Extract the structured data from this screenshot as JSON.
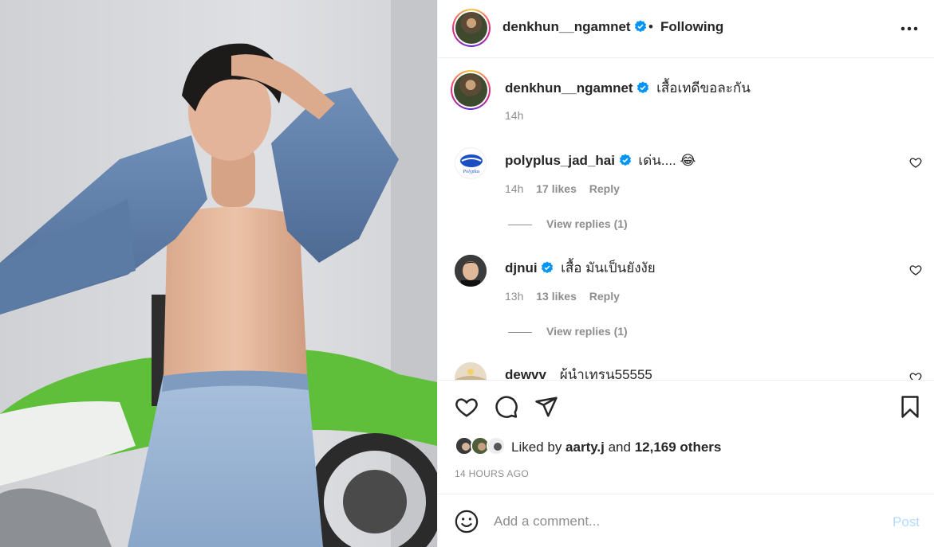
{
  "post": {
    "author": "denkhun__ngamnet",
    "follow_status": "Following",
    "separator": "•",
    "caption": "เสื้อเทดีขอละกัน",
    "caption_time": "14h"
  },
  "comments": [
    {
      "user": "polyplus_jad_hai",
      "verified": true,
      "text": "เด่น.... 😂",
      "time": "14h",
      "likes": "17 likes",
      "reply": "Reply",
      "view_replies": "View replies (1)"
    },
    {
      "user": "djnui",
      "verified": true,
      "text": "เสื้อ มันเป็นยังงัย",
      "time": "13h",
      "likes": "13 likes",
      "reply": "Reply",
      "view_replies": "View replies (1)"
    },
    {
      "user": "dewvv",
      "verified": false,
      "text": "ผู้นำเทรน55555"
    }
  ],
  "likes": {
    "prefix": "Liked by ",
    "user": "aarty.j",
    "mid": " and ",
    "count": "12,169 others"
  },
  "timestamp": "14 HOURS AGO",
  "composer": {
    "placeholder": "Add a comment...",
    "post_label": "Post"
  },
  "icons": {
    "like": "heart-icon",
    "comment": "comment-bubble-icon",
    "share": "paper-plane-icon",
    "save": "bookmark-icon",
    "more": "more-horizontal-icon",
    "emoji": "emoji-icon",
    "verified": "verified-badge-icon"
  },
  "colors": {
    "verified": "#0095f6",
    "post_disabled": "#b3dbff",
    "muted": "#8e8e8e",
    "text": "#262626"
  }
}
